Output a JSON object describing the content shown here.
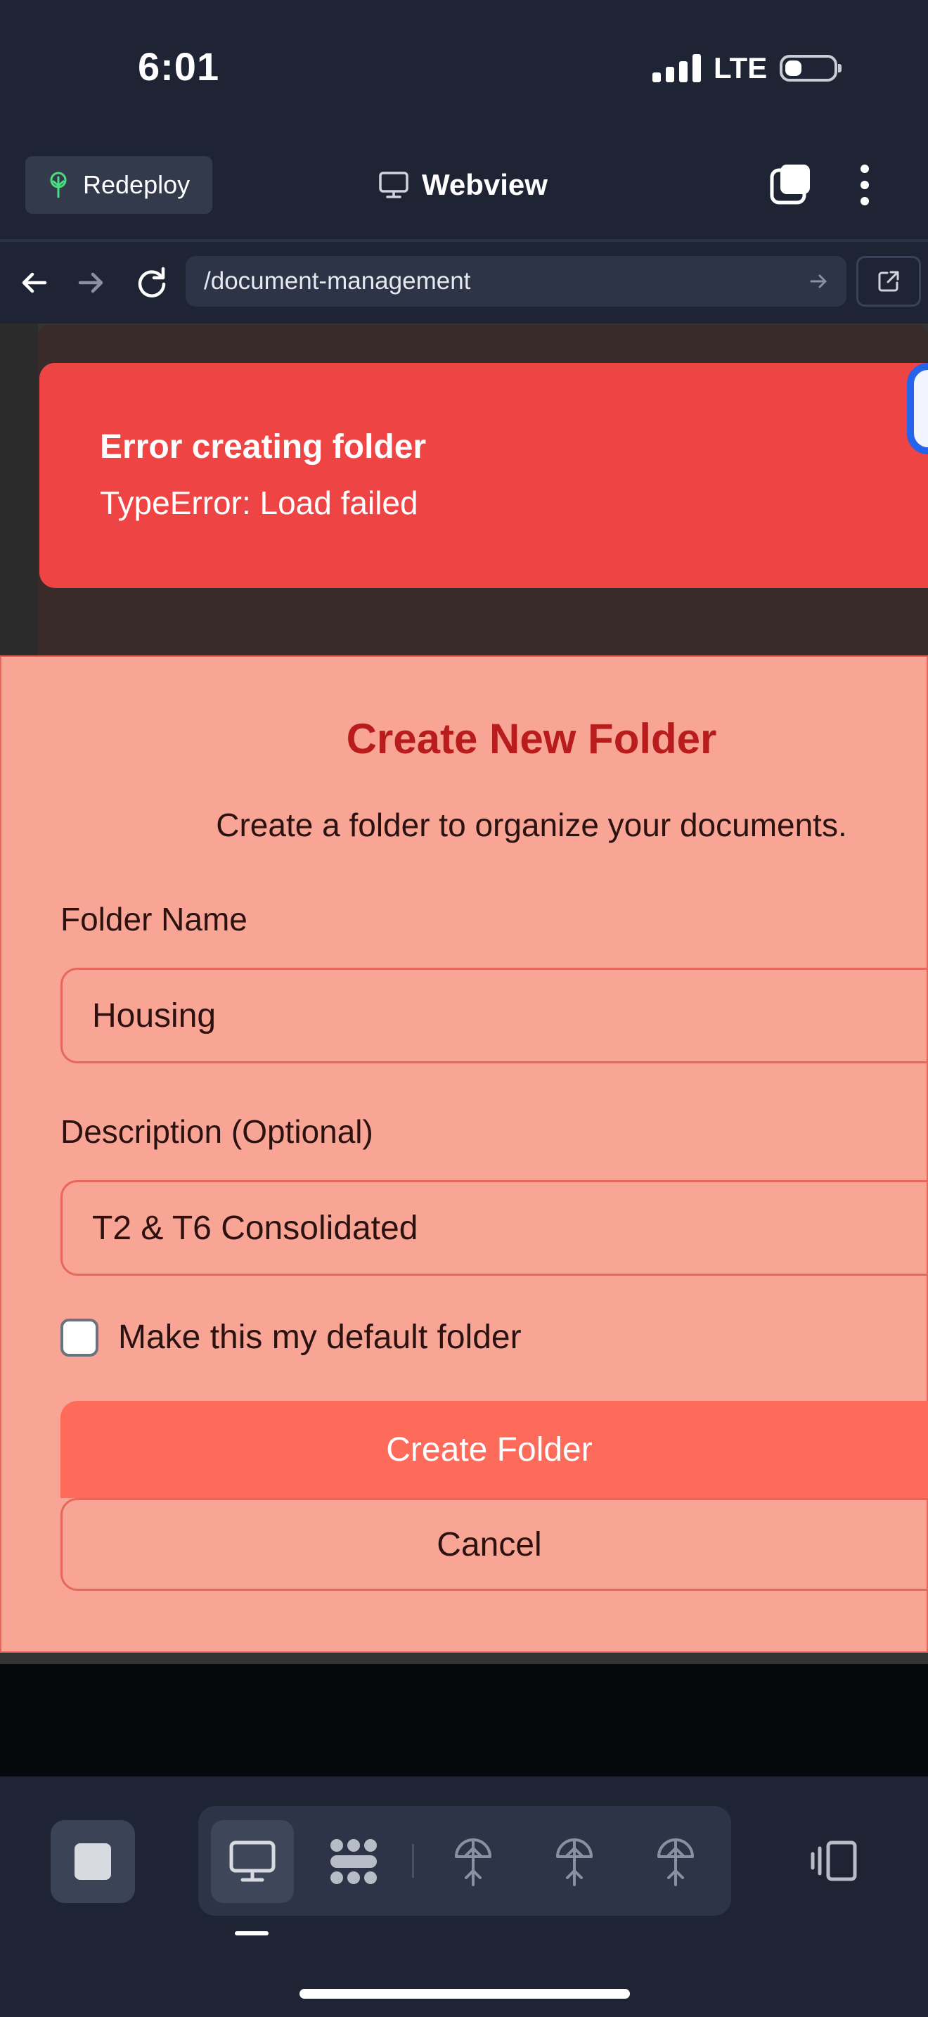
{
  "status_bar": {
    "time": "6:01",
    "network": "LTE",
    "signal_bars": 4,
    "battery_level": 0.35
  },
  "toolbar": {
    "redeploy_label": "Redeploy",
    "title": "Webview"
  },
  "address_bar": {
    "url": "/document-management"
  },
  "toast": {
    "title": "Error creating folder",
    "message": "TypeError: Load failed"
  },
  "dialog": {
    "title": "Create New Folder",
    "subtitle": "Create a folder to organize your documents.",
    "folder_name_label": "Folder Name",
    "folder_name_value": "Housing",
    "description_label": "Description (Optional)",
    "description_value": "T2 & T6 Consolidated",
    "default_checkbox_label": "Make this my default folder",
    "default_checked": false,
    "create_button": "Create Folder",
    "cancel_button": "Cancel"
  },
  "bottom_bar": {
    "icons": [
      "stop-icon",
      "desktop-icon",
      "grid-dots-icon",
      "antenna-icon",
      "antenna-icon",
      "antenna-icon",
      "panel-icon"
    ],
    "active_tab": "desktop"
  },
  "colors": {
    "background": "#1e2433",
    "toast": "#ef4444",
    "dialog": "#f8a596",
    "dialog_title": "#b91c1c",
    "primary_button": "#ff6b5b"
  }
}
